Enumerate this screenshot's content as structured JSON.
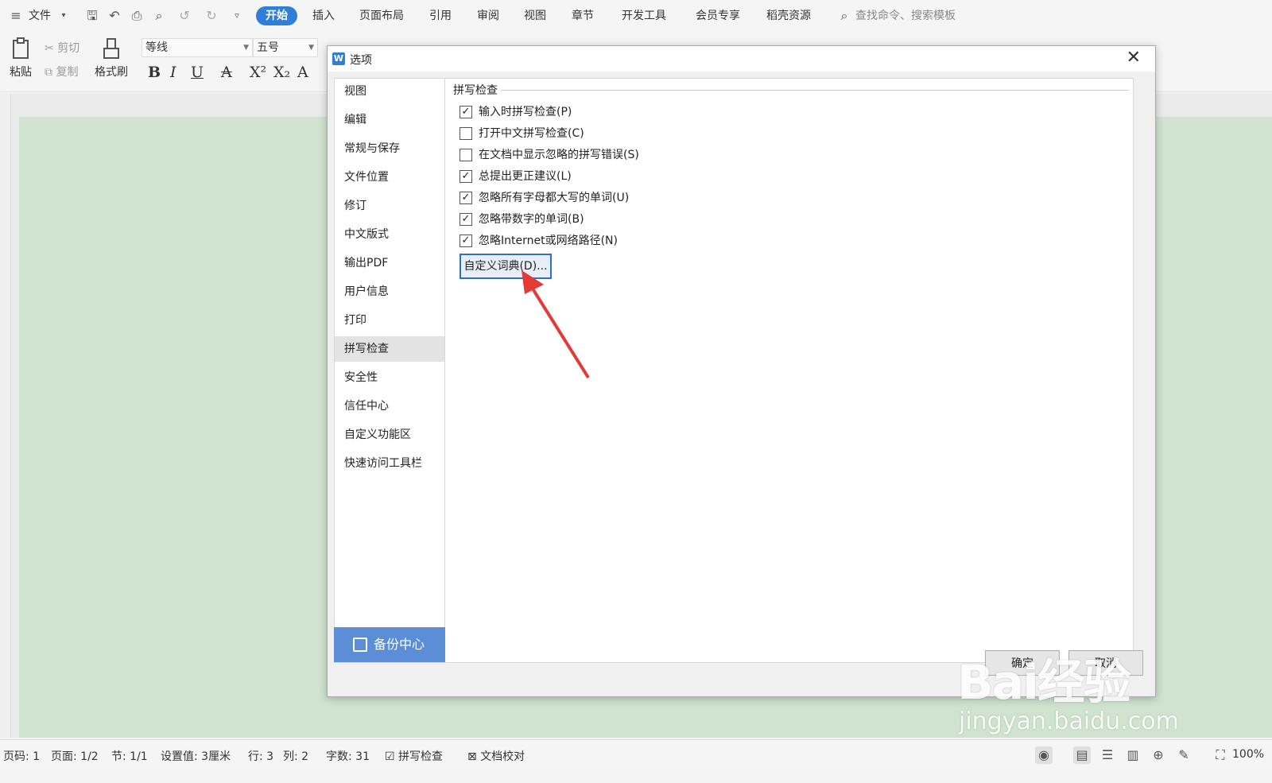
{
  "menubar": {
    "file_label": "文件",
    "tabs": [
      "开始",
      "插入",
      "页面布局",
      "引用",
      "审阅",
      "视图",
      "章节",
      "开发工具",
      "会员专享",
      "稻壳资源"
    ],
    "active_tab": "开始",
    "search_placeholder": "查找命令、搜索模板",
    "accent_color": "#2f7ed8"
  },
  "ribbon": {
    "paste_label": "粘贴",
    "cut_label": "剪切",
    "copy_label": "复制",
    "format_painter_label": "格式刷",
    "font_name": "等线",
    "font_size": "五号"
  },
  "dialog": {
    "title": "选项",
    "nav_items": [
      "视图",
      "编辑",
      "常规与保存",
      "文件位置",
      "修订",
      "中文版式",
      "输出PDF",
      "用户信息",
      "打印",
      "拼写检查",
      "安全性",
      "信任中心",
      "自定义功能区",
      "快速访问工具栏"
    ],
    "active_nav": "拼写检查",
    "backup_label": "备份中心",
    "section_title": "拼写检查",
    "options": [
      {
        "label": "输入时拼写检查(P)",
        "checked": true
      },
      {
        "label": "打开中文拼写检查(C)",
        "checked": false
      },
      {
        "label": "在文档中显示忽略的拼写错误(S)",
        "checked": false
      },
      {
        "label": "总提出更正建议(L)",
        "checked": true
      },
      {
        "label": "忽略所有字母都大写的单词(U)",
        "checked": true
      },
      {
        "label": "忽略带数字的单词(B)",
        "checked": true
      },
      {
        "label": "忽略Internet或网络路径(N)",
        "checked": true
      }
    ],
    "custom_dict_button": "自定义词典(D)...",
    "ok_label": "确定",
    "cancel_label": "取消"
  },
  "statusbar": {
    "page_num": "页码: 1",
    "pages": "页面: 1/2",
    "section": "节: 1/1",
    "setting": "设置值: 3厘米",
    "row": "行: 3",
    "col": "列: 2",
    "word_count": "字数: 31",
    "spell_check": "拼写检查",
    "doc_proof": "文档校对",
    "zoom": "100%"
  },
  "watermark": {
    "brand": "Bai经验",
    "url": "jingyan.baidu.com"
  }
}
